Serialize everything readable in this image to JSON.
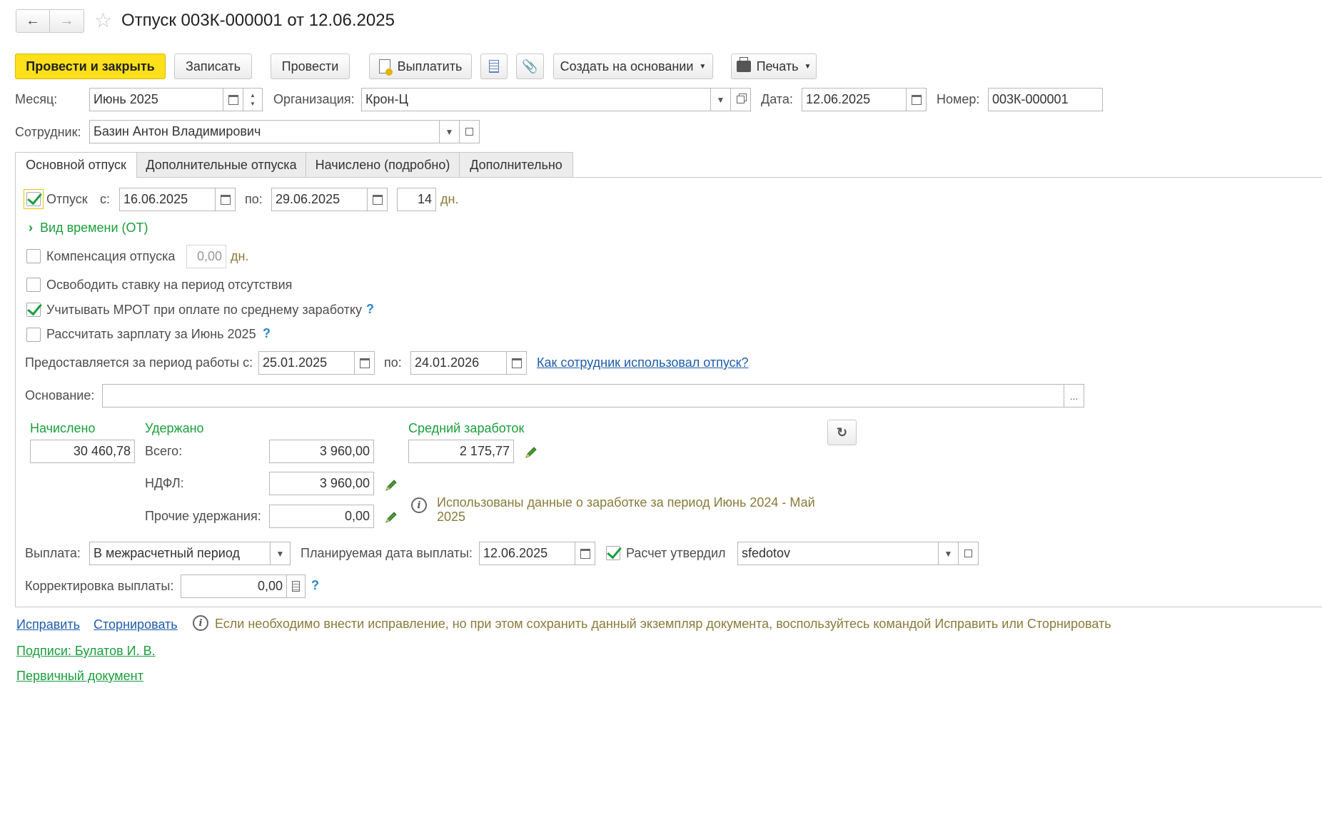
{
  "header": {
    "title": "Отпуск 003К-000001 от 12.06.2025"
  },
  "toolbar": {
    "post_close": "Провести и закрыть",
    "save": "Записать",
    "post": "Провести",
    "pay": "Выплатить",
    "create_based": "Создать на основании",
    "print": "Печать"
  },
  "fields": {
    "month_label": "Месяц:",
    "month_value": "Июнь 2025",
    "org_label": "Организация:",
    "org_value": "Крон-Ц",
    "date_label": "Дата:",
    "date_value": "12.06.2025",
    "number_label": "Номер:",
    "number_value": "003К-000001",
    "employee_label": "Сотрудник:",
    "employee_value": "Базин Антон Владимирович"
  },
  "tabs": [
    {
      "label": "Основной отпуск"
    },
    {
      "label": "Дополнительные отпуска"
    },
    {
      "label": "Начислено (подробно)"
    },
    {
      "label": "Дополнительно"
    }
  ],
  "vacation": {
    "label": "Отпуск",
    "from_label": "с:",
    "from_value": "16.06.2025",
    "to_label": "по:",
    "to_value": "29.06.2025",
    "days_value": "14",
    "days_unit": "дн.",
    "time_type": "Вид времени (ОТ)"
  },
  "options": {
    "compensation_label": "Компенсация отпуска",
    "compensation_value": "0,00",
    "compensation_unit": "дн.",
    "free_rate_label": "Освободить ставку на период отсутствия",
    "mrot_label": "Учитывать МРОТ при оплате по среднему заработку",
    "calc_salary_label": "Рассчитать зарплату за Июнь 2025"
  },
  "period": {
    "label": "Предоставляется за период работы с:",
    "from_value": "25.01.2025",
    "to_label": "по:",
    "to_value": "24.01.2026",
    "usage_link": "Как сотрудник использовал отпуск?"
  },
  "basis": {
    "label": "Основание:",
    "value": ""
  },
  "totals": {
    "accrued_label": "Начислено",
    "accrued_value": "30 460,78",
    "withheld_label": "Удержано",
    "total_label": "Всего:",
    "total_value": "3 960,00",
    "ndfl_label": "НДФЛ:",
    "ndfl_value": "3 960,00",
    "other_label": "Прочие удержания:",
    "other_value": "0,00",
    "avg_label": "Средний заработок",
    "avg_value": "2 175,77",
    "info_text": "Использованы данные о заработке за период Июнь 2024 - Май 2025"
  },
  "payment": {
    "label": "Выплата:",
    "value": "В межрасчетный период",
    "planned_label": "Планируемая дата выплаты:",
    "planned_value": "12.06.2025",
    "approved_label": "Расчет утвердил",
    "approved_value": "sfedotov",
    "correction_label": "Корректировка выплаты:",
    "correction_value": "0,00"
  },
  "footer": {
    "fix_link": "Исправить",
    "reverse_link": "Сторнировать",
    "hint": "Если необходимо внести исправление, но при этом сохранить данный экземпляр документа, воспользуйтесь командой Исправить или Сторнировать",
    "signatures_link": "Подписи: Булатов И. В.",
    "primary_doc_link": "Первичный документ"
  }
}
